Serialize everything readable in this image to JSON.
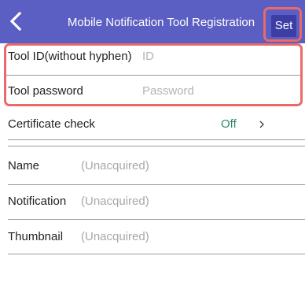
{
  "header": {
    "title": "Mobile Notification Tool Registration",
    "set_label": "Set"
  },
  "fields": {
    "tool_id": {
      "label": "Tool ID(without hyphen)",
      "placeholder": "ID"
    },
    "tool_password": {
      "label": "Tool password",
      "placeholder": "Password"
    },
    "certificate_check": {
      "label": "Certificate check",
      "value": "Off"
    }
  },
  "info": {
    "name": {
      "label": "Name",
      "value": "(Unacquired)"
    },
    "notification": {
      "label": "Notification",
      "value": "(Unacquired)"
    },
    "thumbnail": {
      "label": "Thumbnail",
      "value": "(Unacquired)"
    }
  },
  "colors": {
    "header_bg": "#5b5ec2",
    "set_button_bg": "#3c3ea6",
    "highlight_frame": "#e96a6a",
    "off_value": "#2e8b68"
  },
  "icons": {
    "back": "chevron-left-icon",
    "certificate_chevron": "chevron-right-icon"
  }
}
